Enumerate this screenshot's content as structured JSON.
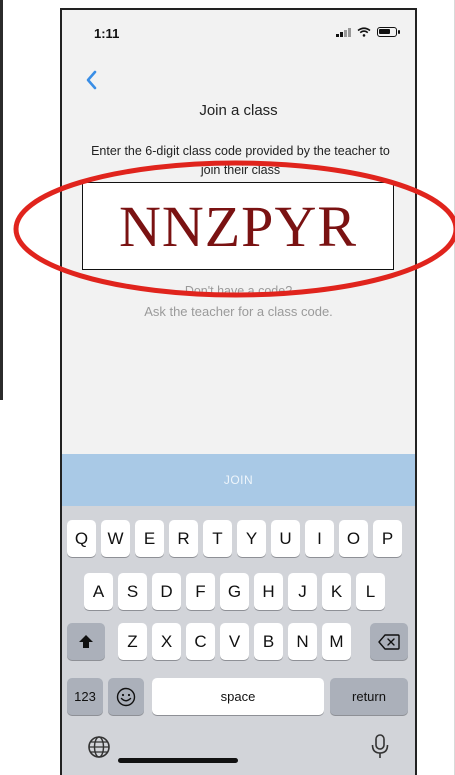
{
  "status_bar": {
    "time": "1:11"
  },
  "header": {
    "title": "Join a class"
  },
  "instruction": "Enter the 6-digit class code provided by the teacher to join their class",
  "class_code": "NNZPYR",
  "help": {
    "no_code": "Don't have a code?",
    "ask_teacher": "Ask the teacher for a class code."
  },
  "join_button": {
    "label": "JOIN"
  },
  "keyboard": {
    "row1": [
      "Q",
      "W",
      "E",
      "R",
      "T",
      "Y",
      "U",
      "I",
      "O",
      "P"
    ],
    "row2": [
      "A",
      "S",
      "D",
      "F",
      "G",
      "H",
      "J",
      "K",
      "L"
    ],
    "row3": [
      "Z",
      "X",
      "C",
      "V",
      "B",
      "N",
      "M"
    ],
    "numbers_key": "123",
    "space_key": "space",
    "return_key": "return"
  },
  "colors": {
    "annotation_ellipse": "#e0241d",
    "code_text": "#7a1212",
    "join_bar": "#a9c9e6",
    "back_chevron": "#3a8ee6"
  }
}
